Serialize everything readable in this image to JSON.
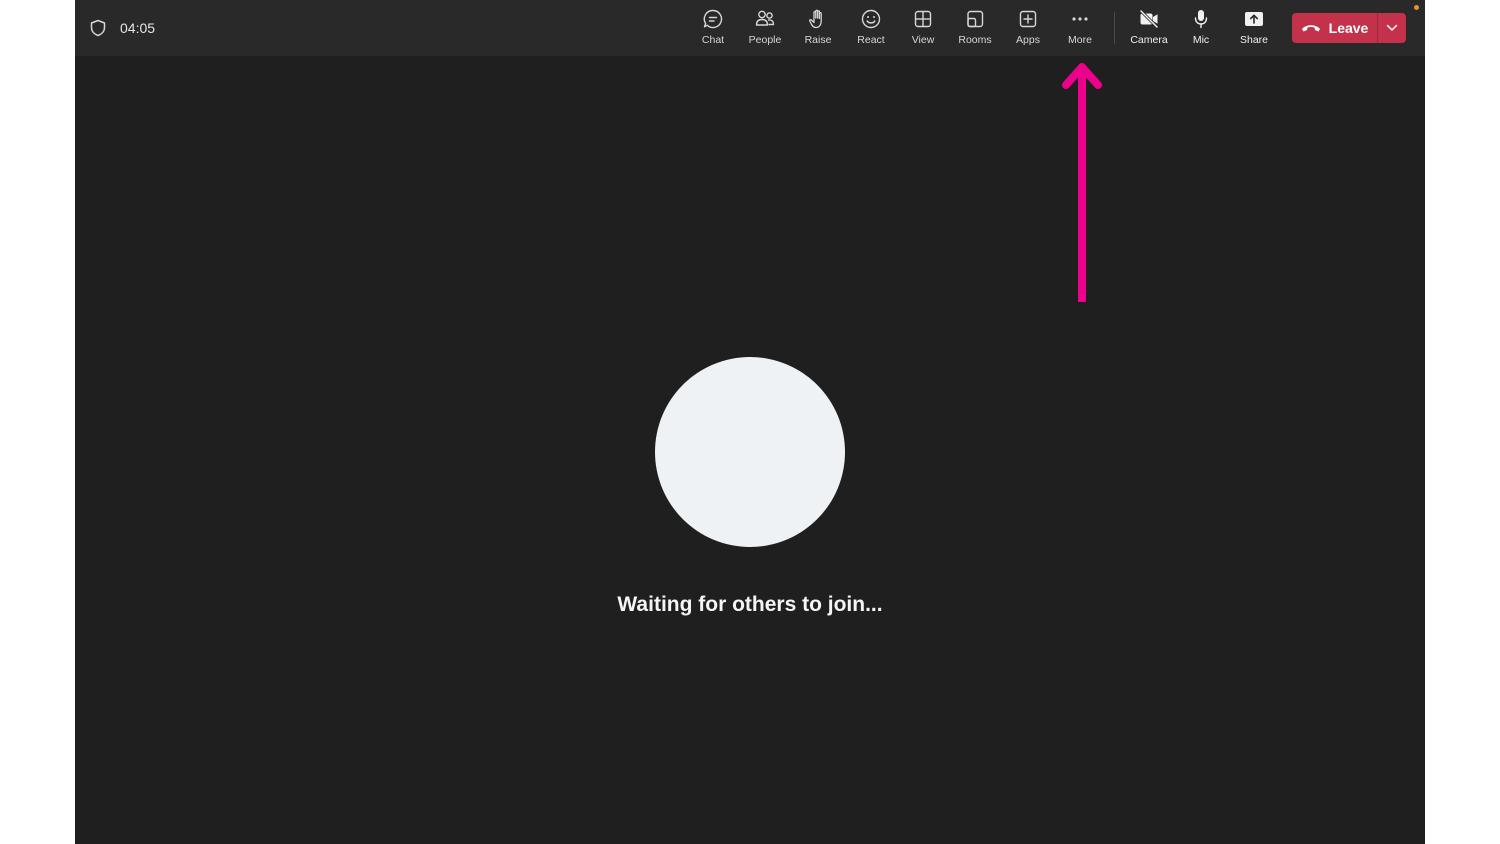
{
  "header": {
    "timer": "04:05",
    "tools": [
      {
        "label": "Chat",
        "icon": "chat-icon"
      },
      {
        "label": "People",
        "icon": "people-icon"
      },
      {
        "label": "Raise",
        "icon": "hand-icon"
      },
      {
        "label": "React",
        "icon": "smile-icon"
      },
      {
        "label": "View",
        "icon": "grid-icon"
      },
      {
        "label": "Rooms",
        "icon": "rooms-icon"
      },
      {
        "label": "Apps",
        "icon": "plus-square-icon"
      },
      {
        "label": "More",
        "icon": "ellipsis-icon"
      },
      {
        "label": "Camera",
        "icon": "camera-off-icon"
      },
      {
        "label": "Mic",
        "icon": "mic-icon"
      },
      {
        "label": "Share",
        "icon": "share-tray-icon"
      }
    ],
    "leave_label": "Leave"
  },
  "main": {
    "waiting_text": "Waiting for others to join..."
  },
  "colors": {
    "background": "#1f1f1f",
    "topbar": "#292929",
    "leave": "#c4314b",
    "annotation_arrow": "#ec008c",
    "avatar": "#eff2f4"
  }
}
